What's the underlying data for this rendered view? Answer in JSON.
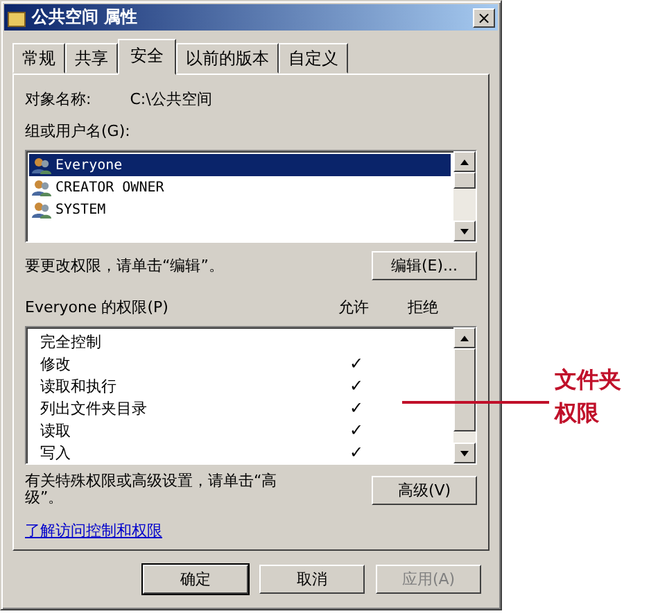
{
  "window": {
    "title": "公共空间 属性",
    "close": "×"
  },
  "tabs": [
    {
      "label": "常规",
      "selected": false
    },
    {
      "label": "共享",
      "selected": false
    },
    {
      "label": "安全",
      "selected": true
    },
    {
      "label": "以前的版本",
      "selected": false
    },
    {
      "label": "自定义",
      "selected": false
    }
  ],
  "object_name": {
    "label": "对象名称:",
    "value": "C:\\公共空间"
  },
  "users": {
    "label": "组或用户名(G):",
    "items": [
      {
        "name": "Everyone",
        "selected": true
      },
      {
        "name": "CREATOR OWNER",
        "selected": false
      },
      {
        "name": "SYSTEM",
        "selected": false
      }
    ]
  },
  "edit_hint": "要更改权限，请单击“编辑”。",
  "edit_button": "编辑(E)...",
  "permissions": {
    "label": "Everyone 的权限(P)",
    "allow_header": "允许",
    "deny_header": "拒绝",
    "check": "✓",
    "rows": [
      {
        "name": "完全控制",
        "allow": false
      },
      {
        "name": "修改",
        "allow": true
      },
      {
        "name": "读取和执行",
        "allow": true
      },
      {
        "name": "列出文件夹目录",
        "allow": true
      },
      {
        "name": "读取",
        "allow": true
      },
      {
        "name": "写入",
        "allow": true
      }
    ]
  },
  "advanced_hint": "有关特殊权限或高级设置，请单击“高级”。",
  "advanced_button": "高级(V)",
  "link": "了解访问控制和权限",
  "buttons": [
    {
      "label": "确定",
      "disabled": false,
      "default": true
    },
    {
      "label": "取消",
      "disabled": false,
      "default": false
    },
    {
      "label": "应用(A)",
      "disabled": true,
      "default": false
    }
  ],
  "annotation": "文件夹权限"
}
